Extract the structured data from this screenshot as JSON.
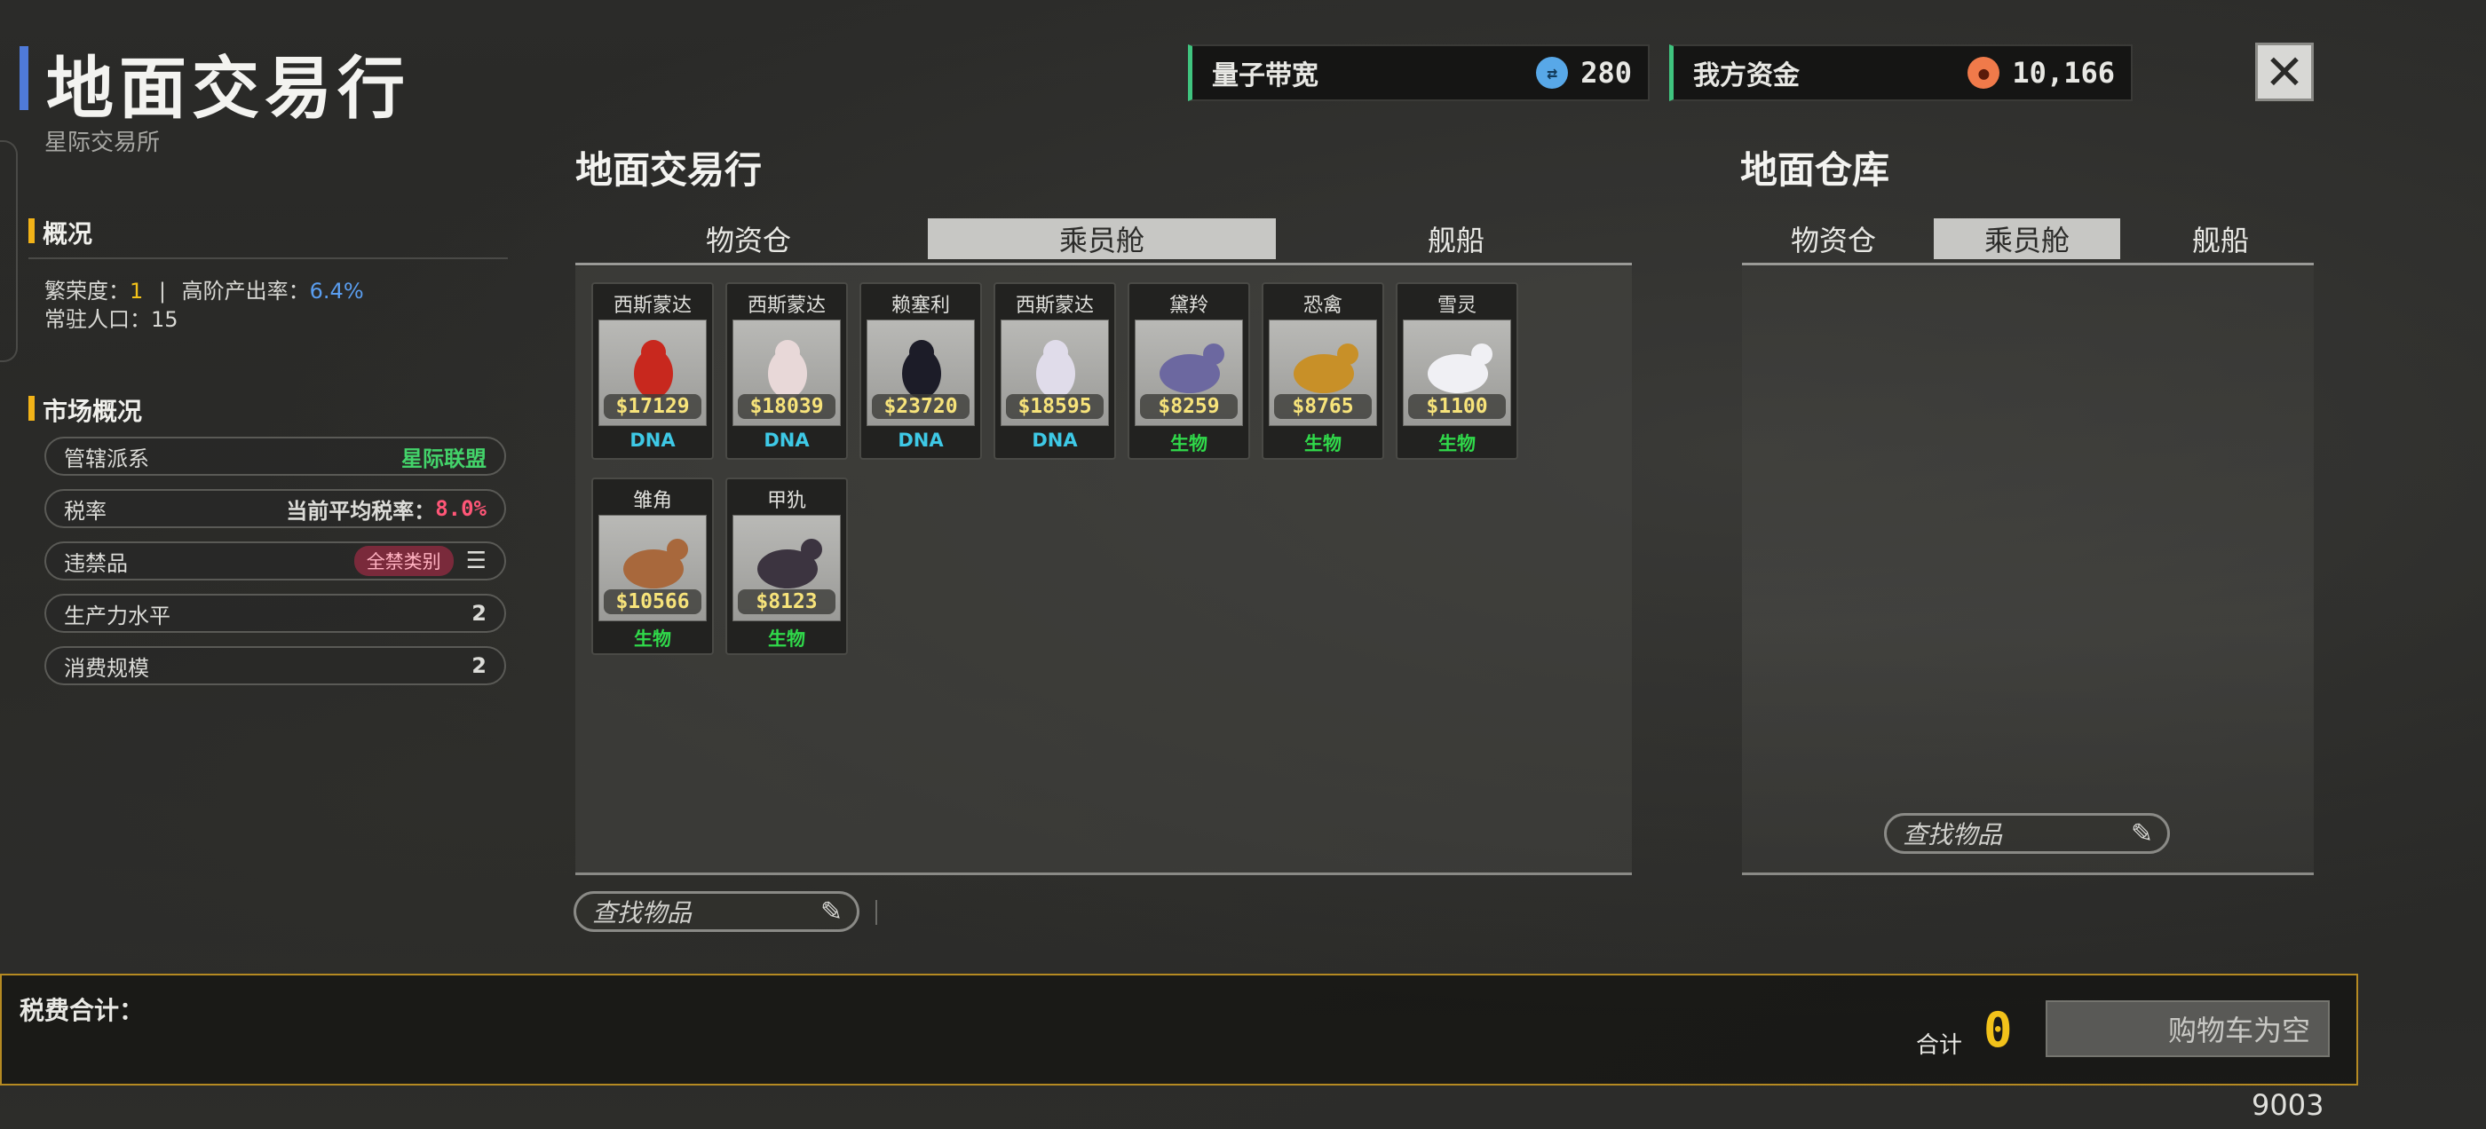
{
  "header": {
    "title": "地面交易行",
    "subtitle": "星际交易所"
  },
  "overview": {
    "heading": "概况",
    "prosperity_label": "繁荣度：",
    "prosperity_value": "1",
    "separator": "|",
    "high_output_label": "高阶产出率：",
    "high_output_value": "6.4%",
    "population_label": "常驻人口：",
    "population_value": "15"
  },
  "market": {
    "heading": "市场概况",
    "rows": [
      {
        "label": "管辖派系",
        "value": "星际联盟"
      },
      {
        "label": "税率",
        "value_label": "当前平均税率：",
        "value": "8.0%"
      },
      {
        "label": "违禁品",
        "badge": "全禁类别",
        "icon": "menu-icon"
      },
      {
        "label": "生产力水平",
        "value": "2"
      },
      {
        "label": "消费规模",
        "value": "2"
      }
    ]
  },
  "resources": {
    "bandwidth_label": "量子带宽",
    "bandwidth_value": "280",
    "bandwidth_icon": "quantum-icon",
    "bandwidth_color": "#58a8e8",
    "funds_label": "我方资金",
    "funds_value": "10,166",
    "funds_icon": "credit-icon",
    "funds_color": "#f07a4a"
  },
  "close_label": "✕",
  "market_panel": {
    "title": "地面交易行",
    "tabs": [
      "物资仓",
      "乘员舱",
      "舰船"
    ],
    "active_tab": 1,
    "items": [
      {
        "name": "西斯蒙达",
        "price": "$17129",
        "category": "DNA",
        "kind": "dna",
        "color": "#c8281e"
      },
      {
        "name": "西斯蒙达",
        "price": "$18039",
        "category": "DNA",
        "kind": "dna",
        "color": "#e8d8d8"
      },
      {
        "name": "赖塞利",
        "price": "$23720",
        "category": "DNA",
        "kind": "dna",
        "color": "#1c1c28"
      },
      {
        "name": "西斯蒙达",
        "price": "$18595",
        "category": "DNA",
        "kind": "dna",
        "color": "#e0dcea"
      },
      {
        "name": "黛羚",
        "price": "$8259",
        "category": "生物",
        "kind": "bio",
        "color": "#6c68a0"
      },
      {
        "name": "恐禽",
        "price": "$8765",
        "category": "生物",
        "kind": "bio",
        "color": "#c89028"
      },
      {
        "name": "雪灵",
        "price": "$1100",
        "category": "生物",
        "kind": "bio",
        "color": "#f0f0f4"
      },
      {
        "name": "雏角",
        "price": "$10566",
        "category": "生物",
        "kind": "bio",
        "color": "#a8683c"
      },
      {
        "name": "甲犰",
        "price": "$8123",
        "category": "生物",
        "kind": "bio",
        "color": "#3c3440"
      }
    ],
    "search_placeholder": "查找物品"
  },
  "warehouse_panel": {
    "title": "地面仓库",
    "tabs": [
      "物资仓",
      "乘员舱",
      "舰船"
    ],
    "active_tab": 1,
    "search_placeholder": "查找物品"
  },
  "footer": {
    "tax_label": "税费合计：",
    "total_label": "合计",
    "total_value": "0",
    "cart_label": "购物车为空"
  },
  "build_number": "9003"
}
